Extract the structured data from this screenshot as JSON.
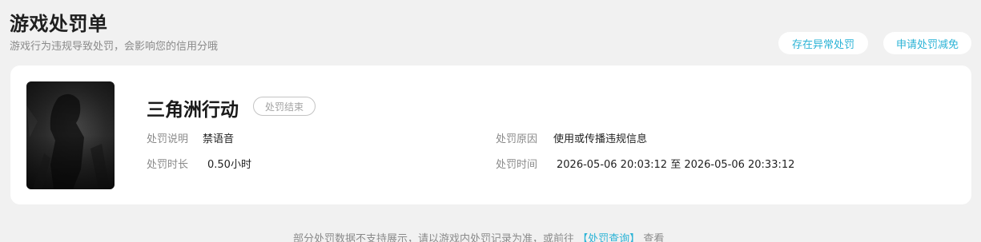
{
  "header": {
    "title": "游戏处罚单",
    "subtitle": "游戏行为违规导致处罚，会影响您的信用分哦"
  },
  "actions": {
    "anomaly_label": "存在异常处罚",
    "appeal_label": "申请处罚减免"
  },
  "record": {
    "game_name": "三角洲行动",
    "status": "处罚结束",
    "description_label": "处罚说明",
    "description_value": "禁语音",
    "duration_label": "处罚时长",
    "duration_value": "0.50小时",
    "reason_label": "处罚原因",
    "reason_value": "使用或传播违规信息",
    "time_label": "处罚时间",
    "time_value": "2026-05-06 20:03:12 至 2026-05-06 20:33:12"
  },
  "footer": {
    "note_prefix": "部分处罚数据不支持展示，请以游戏内处罚记录为准，或前往",
    "link_text": "【处罚查询】",
    "note_suffix": "查看"
  },
  "colors": {
    "accent": "#2bb3d6",
    "background": "#f1f1f1",
    "card": "#ffffff"
  }
}
